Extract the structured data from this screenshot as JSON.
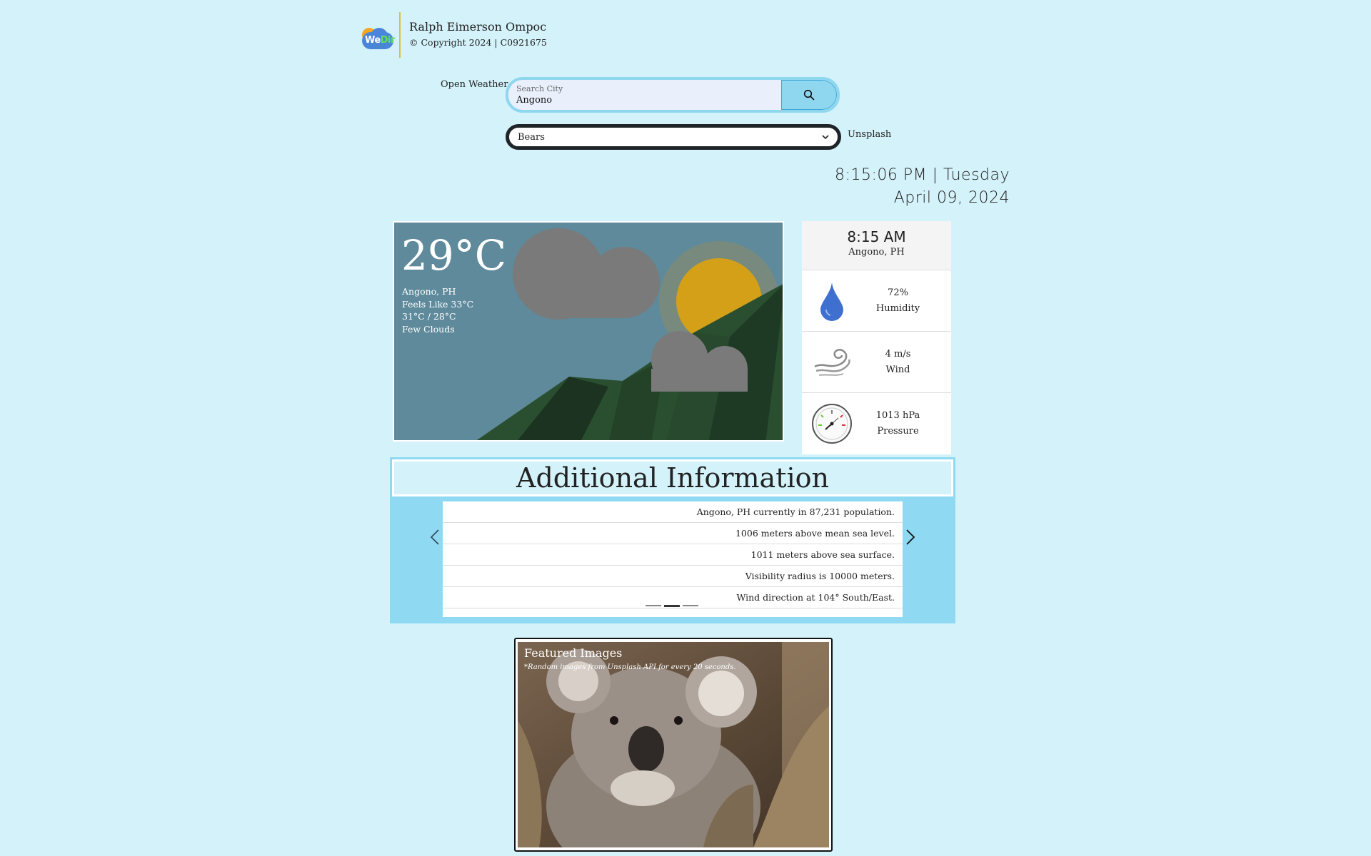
{
  "header": {
    "logo_text_a": "We",
    "logo_text_b": "Dir",
    "author": "Ralph Eimerson Ompoc",
    "copyright": "© Copyright 2024 | C0921675"
  },
  "search": {
    "provider_label": "Open Weather",
    "placeholder": "Search City",
    "value": "Angono",
    "button_icon": "search-icon"
  },
  "image_topic": {
    "selected": "Bears",
    "provider_label": "Unsplash"
  },
  "clock": {
    "time_day": "8:15:06 PM | Tuesday",
    "date": "April 09, 2024"
  },
  "weather": {
    "temperature": "29°C",
    "location": "Angono, PH",
    "feels_like": "Feels Like 33°C",
    "high_low": "31°C / 28°C",
    "condition": "Few Clouds"
  },
  "side_panel": {
    "local_time": "8:15 AM",
    "location": "Angono, PH",
    "humidity_value": "72%",
    "humidity_label": "Humidity",
    "wind_value": "4 m/s",
    "wind_label": "Wind",
    "pressure_value": "1013 hPa",
    "pressure_label": "Pressure"
  },
  "additional": {
    "title": "Additional Information",
    "items": [
      "Angono, PH currently in 87,231 population.",
      "1006 meters above mean sea level.",
      "1011 meters above sea surface.",
      "Visibility radius is 10000 meters.",
      "Wind direction at 104° South/East."
    ],
    "prev_icon": "chevron-left-icon",
    "next_icon": "chevron-right-icon",
    "active_slide": 2,
    "slide_count": 3
  },
  "featured": {
    "title": "Featured Images",
    "note": "*Random images from Unsplash API for every 20 seconds."
  },
  "colors": {
    "background": "#d4f2fa",
    "accent": "#8fd7ef",
    "card_sky": "#5e8a9b",
    "sun": "#d4a017",
    "mountain": "#2a4f30"
  }
}
